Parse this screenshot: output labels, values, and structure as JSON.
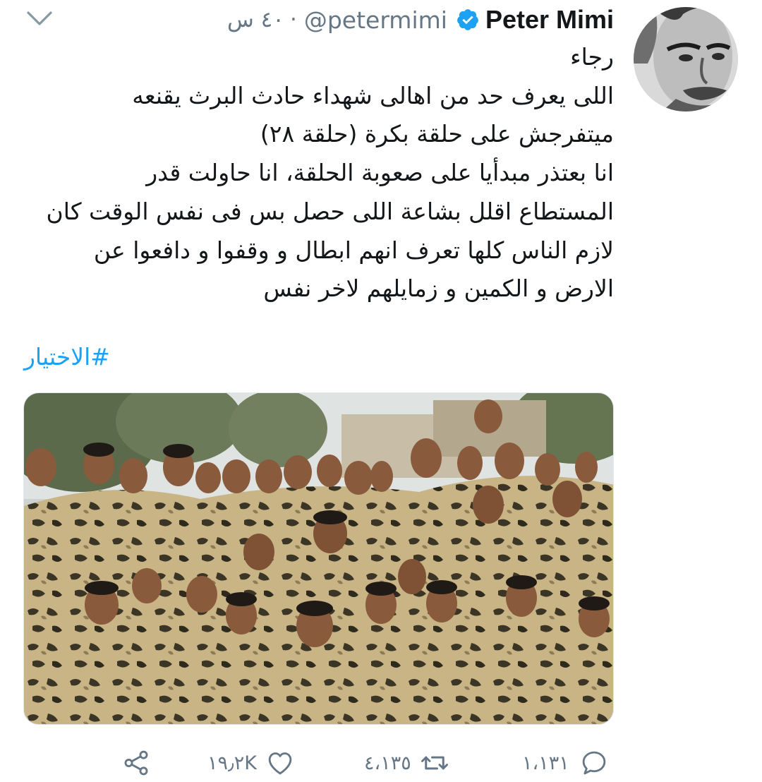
{
  "tweet": {
    "author_name": "Peter Mimi",
    "author_handle": "@petermimi",
    "separator": "·",
    "time": "٤٠ س",
    "verified": true,
    "text_lines": [
      "رجاء",
      "اللى يعرف حد من اهالى شهداء حادث البرث يقنعه",
      "ميتفرجش على حلقة بكرة (حلقة ٢٨)",
      "انا بعتذر مبدأيا على صعوبة الحلقة، انا حاولت قدر",
      "المستطاع اقلل بشاعة اللى حصل بس فى نفس الوقت كان",
      "لازم الناس كلها تعرف انهم ابطال و وقفوا و دافعوا عن",
      "الارض و الكمين و زمايلهم لاخر نفس"
    ],
    "hashtag": "#الاختيار",
    "media": {
      "icon": "photo-soldiers"
    },
    "actions": {
      "reply_count": "١،١٣١",
      "retweet_count": "٤،١٣٥",
      "like_count": "١٩٫٢K",
      "share_icon": "share-icon"
    }
  },
  "colors": {
    "accent": "#1da1f2",
    "muted": "#657786",
    "text": "#14171a"
  }
}
